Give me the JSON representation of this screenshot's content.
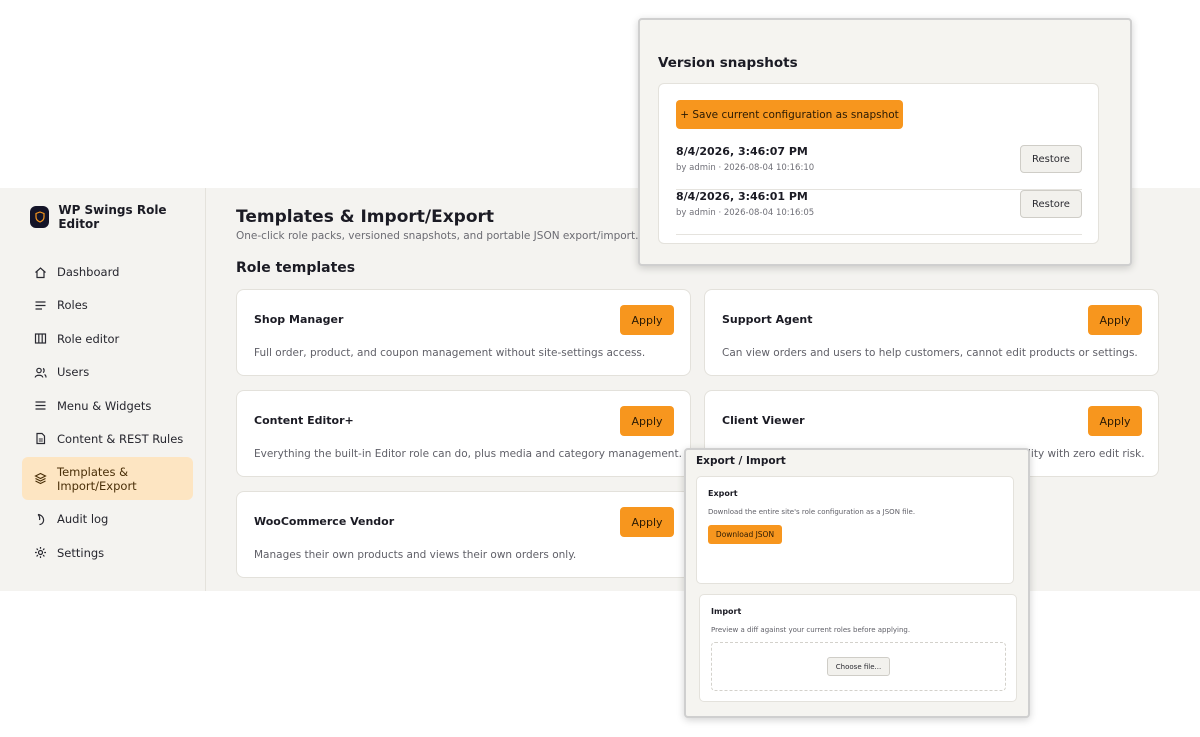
{
  "app": {
    "brand": "WP Swings Role Editor"
  },
  "sidebar": {
    "items": [
      {
        "label": "Dashboard",
        "icon": "home-icon"
      },
      {
        "label": "Roles",
        "icon": "list-icon"
      },
      {
        "label": "Role editor",
        "icon": "columns-icon"
      },
      {
        "label": "Users",
        "icon": "users-icon"
      },
      {
        "label": "Menu & Widgets",
        "icon": "menu-icon"
      },
      {
        "label": "Content & REST Rules",
        "icon": "document-icon"
      },
      {
        "label": "Templates & Import/Export",
        "icon": "layers-icon",
        "active": true
      },
      {
        "label": "Audit log",
        "icon": "history-icon"
      },
      {
        "label": "Settings",
        "icon": "gear-icon"
      }
    ]
  },
  "main": {
    "title": "Templates & Import/Export",
    "subtitle": "One-click role packs, versioned snapshots, and portable JSON export/import.",
    "section_title": "Role templates",
    "apply_label": "Apply",
    "templates": [
      {
        "name": "Shop Manager",
        "description": "Full order, product, and coupon management without site-settings access."
      },
      {
        "name": "Support Agent",
        "description": "Can view orders and users to help customers, cannot edit products or settings."
      },
      {
        "name": "Content Editor+",
        "description": "Everything the built-in Editor role can do, plus media and category management."
      },
      {
        "name": "Client Viewer",
        "description": "lity with zero edit risk."
      },
      {
        "name": "WooCommerce Vendor",
        "description": "Manages their own products and views their own orders only."
      }
    ]
  },
  "snapshots": {
    "title": "Version snapshots",
    "save_label": "+ Save current configuration as snapshot",
    "restore_label": "Restore",
    "items": [
      {
        "date": "8/4/2026, 3:46:07 PM",
        "meta": "by admin · 2026-08-04 10:16:10"
      },
      {
        "date": "8/4/2026, 3:46:01 PM",
        "meta": "by admin · 2026-08-04 10:16:05"
      }
    ]
  },
  "export_import": {
    "title": "Export / Import",
    "export": {
      "title": "Export",
      "description": "Download the entire site's role configuration as a JSON file.",
      "button": "Download JSON"
    },
    "import": {
      "title": "Import",
      "description": "Preview a diff against your current roles before applying.",
      "button": "Choose file..."
    }
  },
  "colors": {
    "accent": "#f7961e",
    "active_nav_bg": "#fde5c2",
    "brand_logo_bg": "#141428",
    "page_bg": "#f4f3f0"
  }
}
